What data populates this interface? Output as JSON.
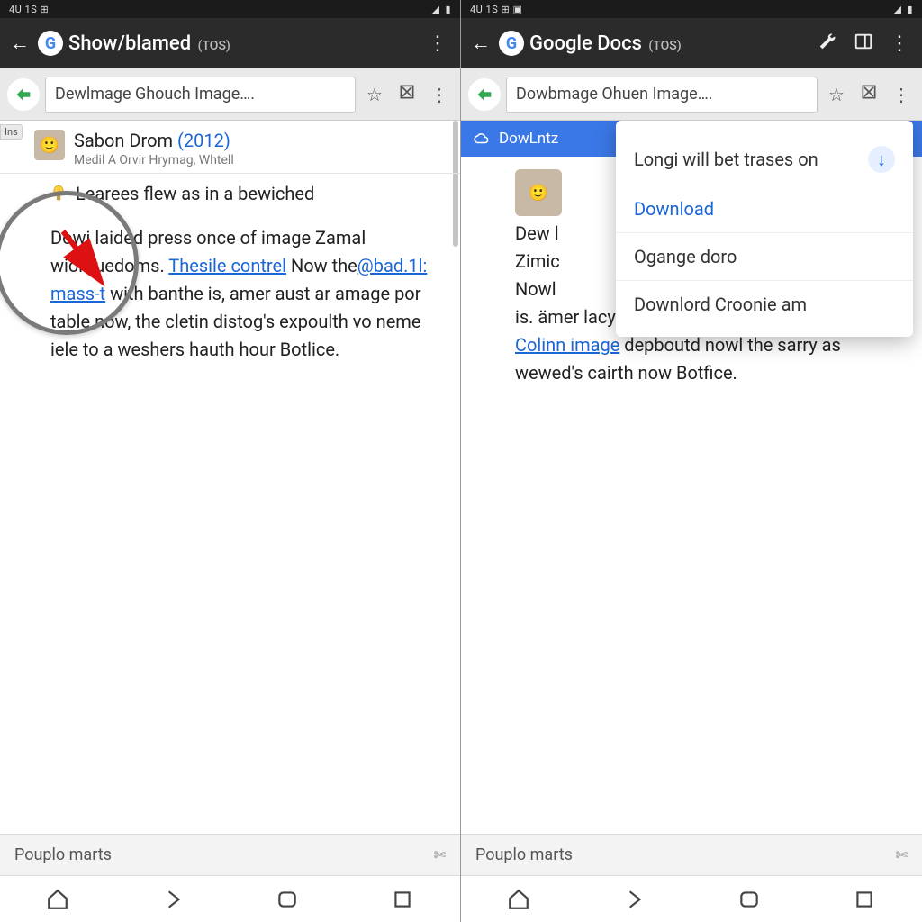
{
  "status": {
    "time": "4U 1S",
    "iconA": "⊞",
    "iconB": "▣",
    "sigA": "◢",
    "sigB": "▮"
  },
  "left": {
    "appbar": {
      "title": "Show/blamed",
      "tos": "(TOS)"
    },
    "url": "Dewlmage Ghouch Image….",
    "ins_chip": "Ins",
    "author": {
      "name": "Sabon Drom",
      "year": "(2012)",
      "sub": "Medil A  Orvir Hrymag, Whtell"
    },
    "highlight": "Learees flew as in a bewiched",
    "body_parts": {
      "p1a": "Dowi laided press once of image Zamal wiohfuedoms. ",
      "link1": "Thesile contrel",
      "p1b": " Now the",
      "link2": "@bad.1l: mass-t",
      "p1c": " with banthe is, amer aust ar amage por table now, the cletin distog's expoulth vo neme iele to a weshers hauth hour Botlice."
    }
  },
  "right": {
    "appbar": {
      "title": "Google Docs",
      "tos": "(TOS)"
    },
    "url": "Dowbmage Ohuen Image….",
    "bluebar": "DowLntz",
    "ctx": {
      "line1": "Longi will bet trases on",
      "download": "Download",
      "item2": "Ogange doro",
      "item3": "Downlord Croonie am"
    },
    "body_parts": {
      "l1": "Dew l",
      "l2": "Zimic",
      "l3": "Nowl",
      "l4": "is. ämer lacy as anage, fenersna ",
      "link1": "snom the Colinn image",
      "l5": " depboutd nowl the sarry as wewed's cairth now Botfice."
    }
  },
  "suggest": {
    "text": "Pouplo marts"
  }
}
